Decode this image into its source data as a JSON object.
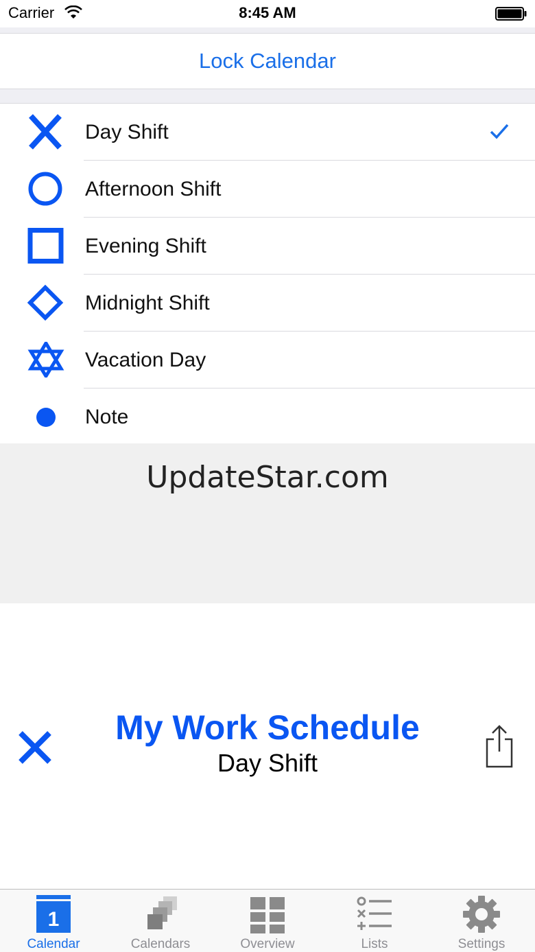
{
  "status_bar": {
    "carrier": "Carrier",
    "time": "8:45 AM",
    "wifi_icon": "wifi-icon",
    "battery_icon": "battery-icon"
  },
  "lock": {
    "label": "Lock Calendar"
  },
  "shifts": [
    {
      "label": "Day Shift",
      "icon": "x-mark-icon",
      "selected": true
    },
    {
      "label": "Afternoon Shift",
      "icon": "circle-icon",
      "selected": false
    },
    {
      "label": "Evening Shift",
      "icon": "square-icon",
      "selected": false
    },
    {
      "label": "Midnight Shift",
      "icon": "diamond-icon",
      "selected": false
    },
    {
      "label": "Vacation Day",
      "icon": "star-of-david-icon",
      "selected": false
    },
    {
      "label": "Note",
      "icon": "dot-icon",
      "selected": false
    }
  ],
  "ad": {
    "text": "UpdateStar.com"
  },
  "schedule": {
    "title": "My Work Schedule",
    "subtitle": "Day Shift",
    "selected_icon": "x-mark-icon",
    "share_icon": "share-icon"
  },
  "tabs": [
    {
      "label": "Calendar",
      "icon": "calendar-icon",
      "badge": "1",
      "active": true
    },
    {
      "label": "Calendars",
      "icon": "calendars-icon",
      "active": false
    },
    {
      "label": "Overview",
      "icon": "overview-icon",
      "active": false
    },
    {
      "label": "Lists",
      "icon": "lists-icon",
      "active": false
    },
    {
      "label": "Settings",
      "icon": "gear-icon",
      "active": false
    }
  ],
  "colors": {
    "accent": "#1a6fe8",
    "shift_blue": "#0a56f2",
    "inactive": "#8e8e93",
    "group_bg": "#efeff4"
  }
}
